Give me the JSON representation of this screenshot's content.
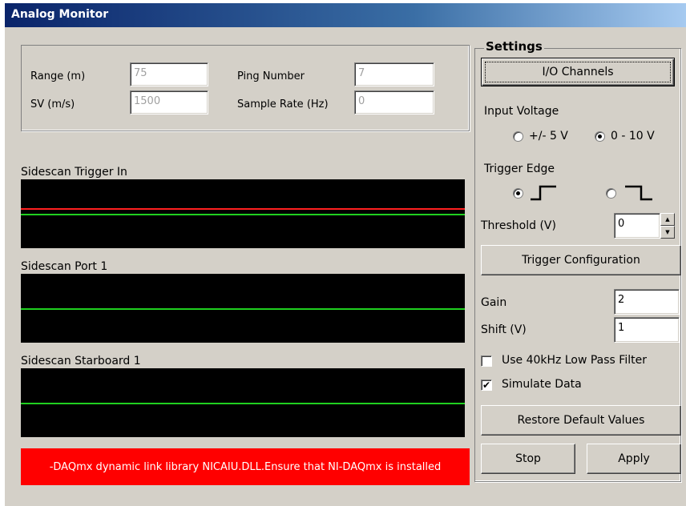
{
  "window": {
    "title": "Analog Monitor"
  },
  "info": {
    "range_label": "Range (m)",
    "range_value": "75",
    "sv_label": "SV (m/s)",
    "sv_value": "1500",
    "ping_label": "Ping Number",
    "ping_value": "7",
    "sample_rate_label": "Sample Rate (Hz)",
    "sample_rate_value": "0"
  },
  "scopes": [
    {
      "label": "Sidescan Trigger In",
      "traces": [
        {
          "level": 0.42,
          "color": "#ff2020"
        },
        {
          "level": 0.5,
          "color": "#20d020"
        }
      ]
    },
    {
      "label": "Sidescan Port 1",
      "traces": [
        {
          "level": 0.5,
          "color": "#20d020"
        }
      ]
    },
    {
      "label": "Sidescan Starboard 1",
      "traces": [
        {
          "level": 0.5,
          "color": "#20d020"
        }
      ]
    }
  ],
  "error": {
    "text": "-DAQmx dynamic link library NICAIU.DLL.Ensure that NI-DAQmx is installed",
    "color": "#ff0000"
  },
  "settings": {
    "title": "Settings",
    "io_channels": "I/O Channels",
    "input_voltage_label": "Input Voltage",
    "voltage_options": [
      "+/- 5 V",
      "0 - 10 V"
    ],
    "voltage_selected": 1,
    "trigger_edge_label": "Trigger Edge",
    "trigger_edge_options": [
      "rising-edge-icon",
      "falling-edge-icon"
    ],
    "trigger_edge_selected": 0,
    "threshold_label": "Threshold (V)",
    "threshold_value": "0",
    "trigger_configuration": "Trigger Configuration",
    "gain_label": "Gain",
    "gain_value": "2",
    "shift_label": "Shift (V)",
    "shift_value": "1",
    "lowpass_label": "Use 40kHz Low Pass Filter",
    "lowpass_checked": false,
    "simulate_label": "Simulate Data",
    "simulate_checked": true,
    "restore_defaults": "Restore Default Values",
    "stop": "Stop",
    "apply": "Apply"
  }
}
